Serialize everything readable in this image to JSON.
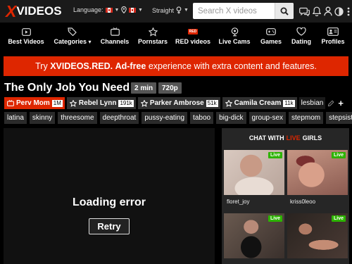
{
  "header": {
    "logo_x": "X",
    "logo_rest": "VIDEOS",
    "language_label": "Language:",
    "language_flag": "canada-flag",
    "location_flag": "canada-flag",
    "orientation_label": "Straight",
    "search_placeholder": "Search X videos",
    "icons": [
      "chat-icon",
      "bell-icon",
      "user-icon",
      "contrast-icon",
      "menu-icon"
    ]
  },
  "nav": {
    "items": [
      {
        "label": "Best Videos",
        "icon": "play-square-icon"
      },
      {
        "label": "Categories",
        "icon": "tags-icon",
        "caret": "▾"
      },
      {
        "label": "Channels",
        "icon": "tv-icon"
      },
      {
        "label": "Pornstars",
        "icon": "star-icon"
      },
      {
        "label": "RED videos",
        "icon": "red-badge-icon",
        "badge": "RED"
      },
      {
        "label": "Live Cams",
        "icon": "webcam-icon"
      },
      {
        "label": "Games",
        "icon": "gamepad-icon"
      },
      {
        "label": "Dating",
        "icon": "heart-icon"
      },
      {
        "label": "Profiles",
        "icon": "profile-icon"
      }
    ]
  },
  "promo": {
    "pre": "Try ",
    "brand": "XVIDEOS.RED",
    "mid": ". ",
    "bold": "Ad-free",
    "post": " experience with extra content and features."
  },
  "video": {
    "title": "The Only Job You Need",
    "duration": "2 min",
    "quality": "720p"
  },
  "models": [
    {
      "name": "Perv Mom",
      "count": "1M",
      "main": true
    },
    {
      "name": "Rebel Lynn",
      "count": "191k"
    },
    {
      "name": "Parker Ambrose",
      "count": "51k"
    },
    {
      "name": "Camila Cream",
      "count": "11k"
    }
  ],
  "extra_tag": "lesbian",
  "keywords": [
    "latina",
    "skinny",
    "threesome",
    "deepthroat",
    "pussy-eating",
    "taboo",
    "big-dick",
    "group-sex",
    "stepmom",
    "stepsister"
  ],
  "player": {
    "error": "Loading error",
    "retry": "Retry"
  },
  "live": {
    "head_pre": "CHAT WITH",
    "head_live": "LIVE",
    "head_post": "GIRLS",
    "badge": "Live",
    "cams": [
      {
        "name": "floret_joy"
      },
      {
        "name": "kriss0leoo"
      },
      {
        "name": ""
      },
      {
        "name": ""
      }
    ]
  },
  "colors": {
    "brand_red": "#de2600",
    "live_green": "#2db300"
  }
}
